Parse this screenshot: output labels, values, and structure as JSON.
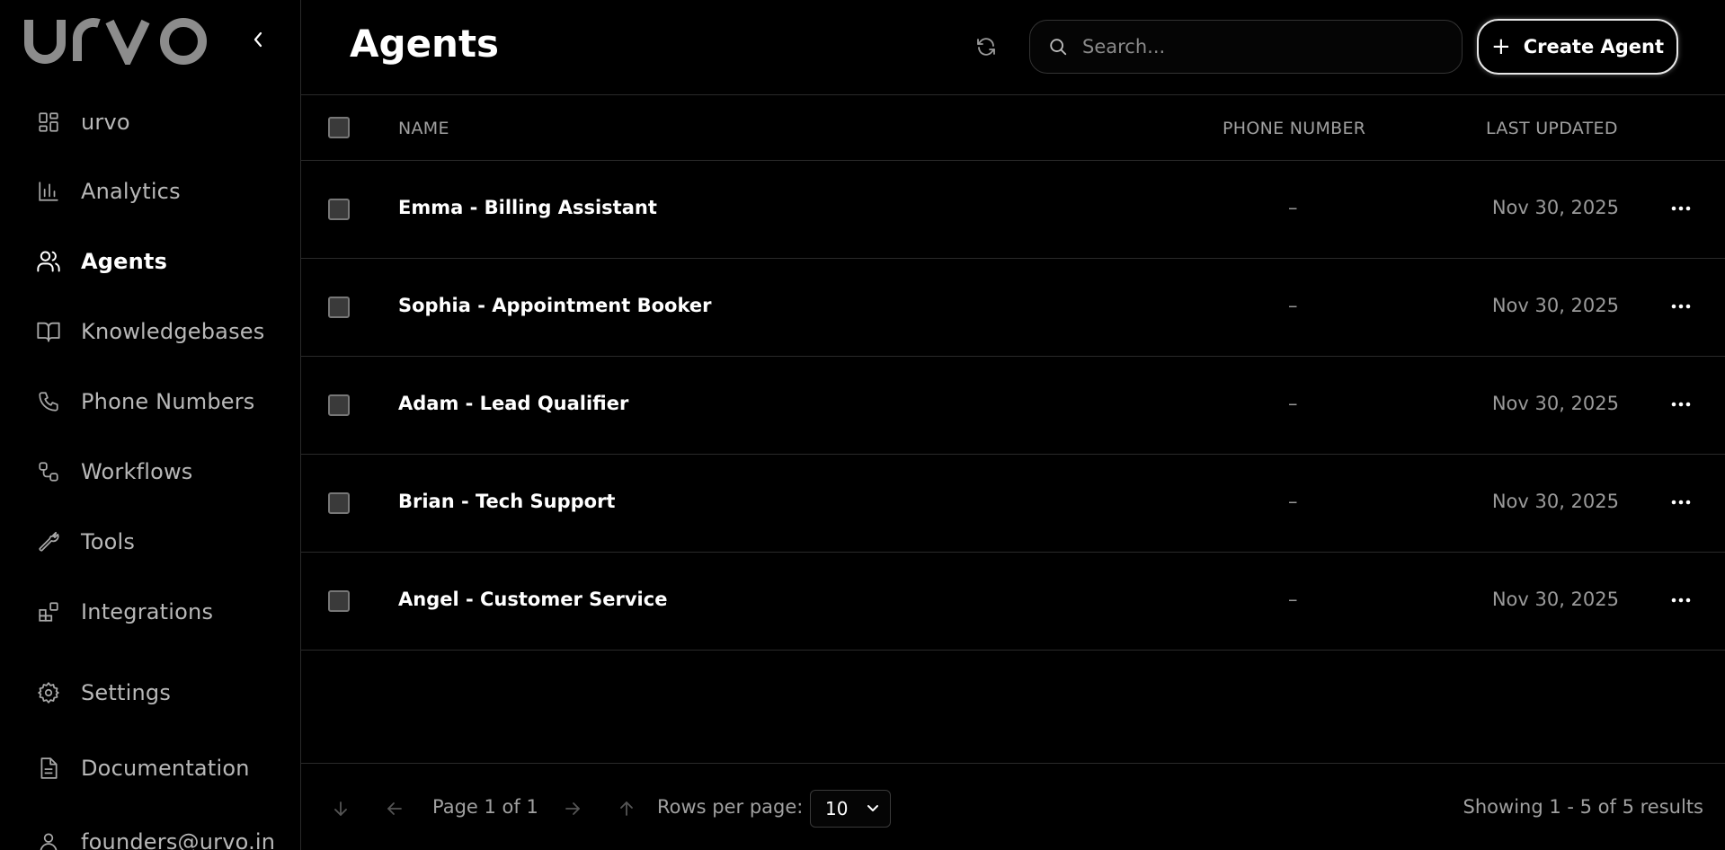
{
  "sidebar": {
    "logo_text": "urvo",
    "items": [
      {
        "label": "urvo",
        "icon": "dashboard-grid-icon"
      },
      {
        "label": "Analytics",
        "icon": "bar-chart-icon"
      },
      {
        "label": "Agents",
        "icon": "users-icon",
        "active": true
      },
      {
        "label": "Knowledgebases",
        "icon": "book-open-icon"
      },
      {
        "label": "Phone Numbers",
        "icon": "phone-icon"
      },
      {
        "label": "Workflows",
        "icon": "workflow-icon"
      },
      {
        "label": "Tools",
        "icon": "wrench-icon"
      },
      {
        "label": "Integrations",
        "icon": "blocks-icon"
      },
      {
        "label": "Settings",
        "icon": "gear-icon"
      },
      {
        "label": "Documentation",
        "icon": "document-icon"
      }
    ],
    "user_email": "founders@urvo.in"
  },
  "header": {
    "title": "Agents",
    "search_placeholder": "Search...",
    "create_label": "Create Agent"
  },
  "table": {
    "columns": {
      "name": "NAME",
      "phone": "PHONE NUMBER",
      "updated": "LAST UPDATED"
    },
    "rows": [
      {
        "name": "Emma - Billing Assistant",
        "phone": "–",
        "updated": "Nov 30, 2025"
      },
      {
        "name": "Sophia - Appointment Booker",
        "phone": "–",
        "updated": "Nov 30, 2025"
      },
      {
        "name": "Adam - Lead Qualifier",
        "phone": "–",
        "updated": "Nov 30, 2025"
      },
      {
        "name": "Brian - Tech Support",
        "phone": "–",
        "updated": "Nov 30, 2025"
      },
      {
        "name": "Angel - Customer Service",
        "phone": "–",
        "updated": "Nov 30, 2025"
      }
    ]
  },
  "footer": {
    "page_text": "Page 1 of 1",
    "rows_per_page_label": "Rows per page:",
    "rows_per_page_value": "10",
    "results_text": "Showing 1 - 5 of 5 results"
  },
  "colors": {
    "background": "#000000",
    "border": "#2a2a2a",
    "text": "#ffffff",
    "muted": "#a0a0a0"
  }
}
